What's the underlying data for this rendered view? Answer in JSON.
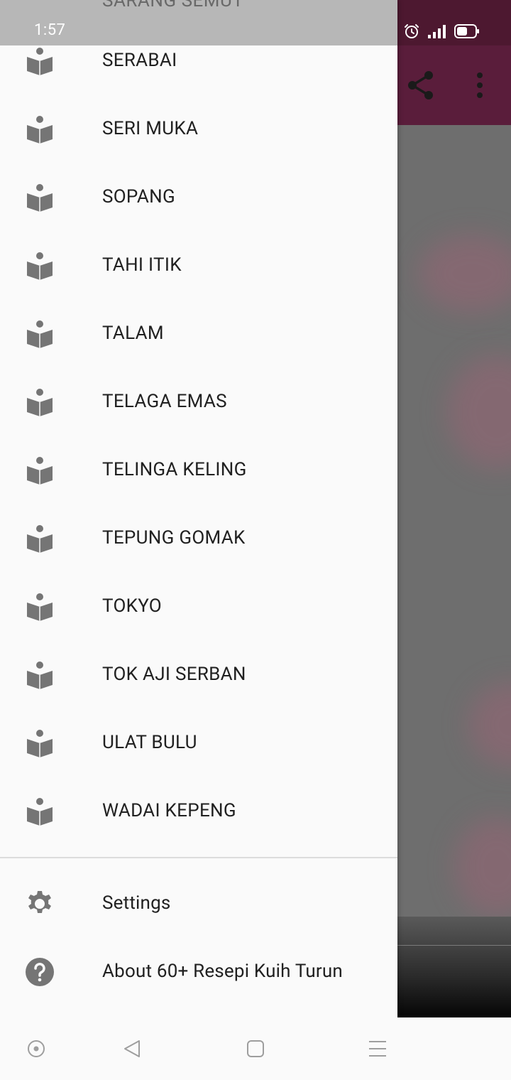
{
  "status_bar": {
    "time": "1:57"
  },
  "drawer": {
    "partial_item_label": "SARANG SEMUT",
    "menu_items": [
      {
        "label": "SERABAI",
        "icon": "book-reader-icon"
      },
      {
        "label": "SERI MUKA",
        "icon": "book-reader-icon"
      },
      {
        "label": "SOPANG",
        "icon": "book-reader-icon"
      },
      {
        "label": "TAHI ITIK",
        "icon": "book-reader-icon"
      },
      {
        "label": "TALAM",
        "icon": "book-reader-icon"
      },
      {
        "label": "TELAGA EMAS",
        "icon": "book-reader-icon"
      },
      {
        "label": "TELINGA KELING",
        "icon": "book-reader-icon"
      },
      {
        "label": "TEPUNG GOMAK",
        "icon": "book-reader-icon"
      },
      {
        "label": "TOKYO",
        "icon": "book-reader-icon"
      },
      {
        "label": "TOK AJI SERBAN",
        "icon": "book-reader-icon"
      },
      {
        "label": "ULAT BULU",
        "icon": "book-reader-icon"
      },
      {
        "label": "WADAI KEPENG",
        "icon": "book-reader-icon"
      }
    ],
    "settings": {
      "label": "Settings",
      "icon": "gear-icon"
    },
    "about": {
      "label": "About 60+ Resepi Kuih Turun",
      "icon": "help-circle-icon"
    }
  },
  "toolbar": {
    "share_icon": "share-icon",
    "more_icon": "more-vert-icon"
  },
  "colors": {
    "toolbar": "#5a1d3b",
    "status_bar": "#4d1830",
    "icon_grey": "#757575",
    "text": "#212121",
    "drawer_bg": "#fafafa"
  },
  "navigation_bar": {
    "icons": [
      "assistant-icon",
      "back-icon",
      "home-icon",
      "recents-icon"
    ]
  }
}
